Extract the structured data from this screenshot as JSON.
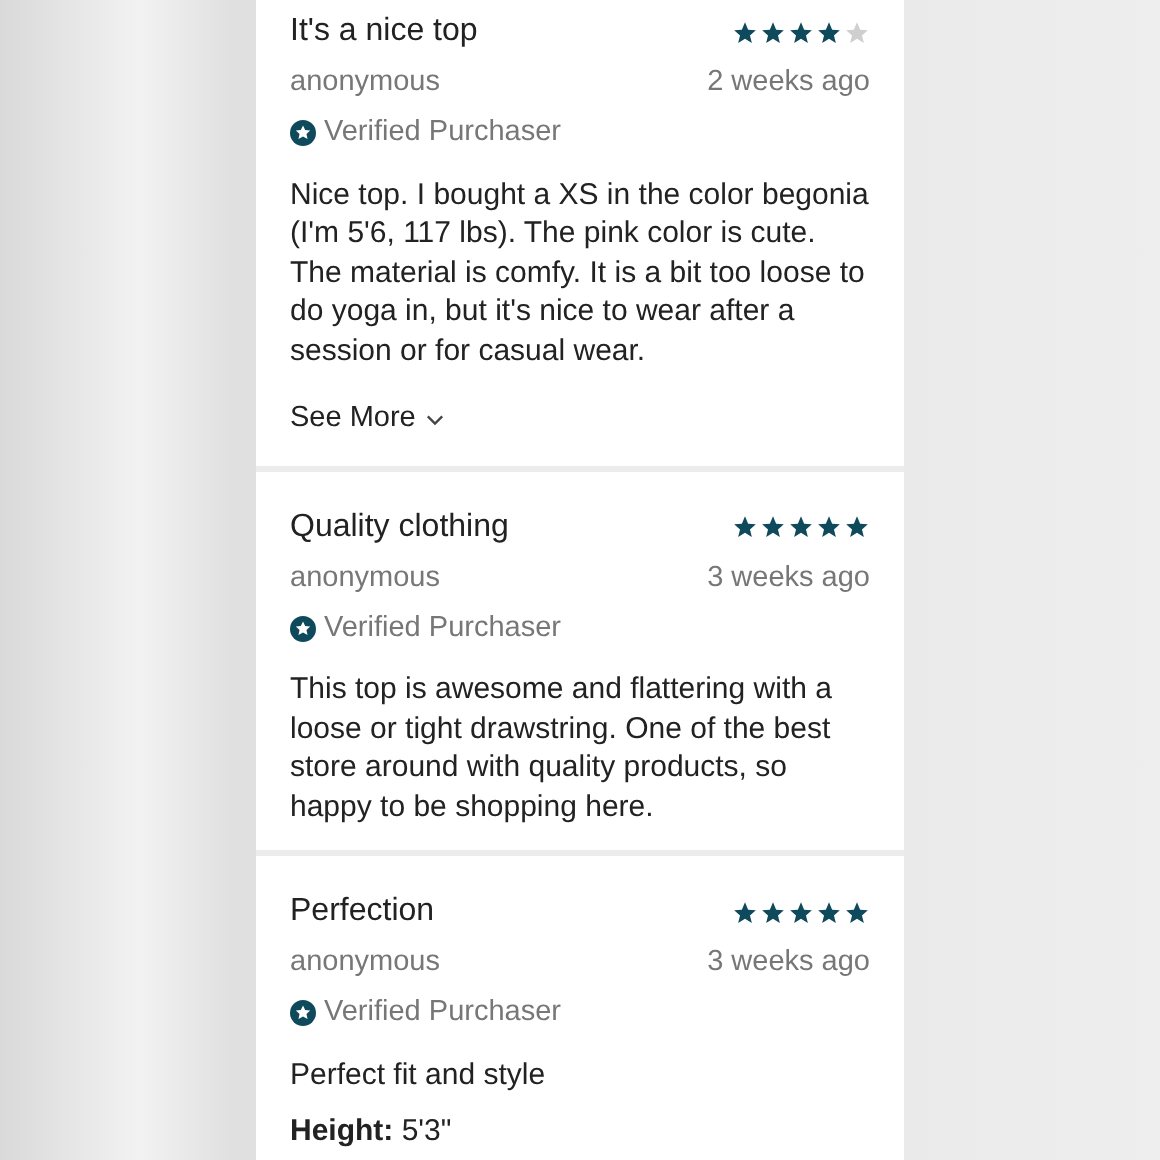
{
  "reviews": [
    {
      "title": "It's a nice top",
      "stars": 4,
      "author": "anonymous",
      "date": "2 weeks ago",
      "badge": "Verified Purchaser",
      "body": "Nice top. I bought a XS in the color begonia (I'm 5'6, 117 lbs). The pink color is cute. The material is comfy. It is a bit too loose to do yoga in, but it's nice to wear after a session or for casual wear.",
      "see_more": "See More"
    },
    {
      "title": "Quality clothing",
      "stars": 5,
      "author": "anonymous",
      "date": "3 weeks ago",
      "badge": "Verified Purchaser",
      "body": "This top is awesome and flattering with a loose or tight drawstring. One of the best store around with quality products, so happy to be shopping here."
    },
    {
      "title": "Perfection",
      "stars": 5,
      "author": "anonymous",
      "date": "3 weeks ago",
      "badge": "Verified Purchaser",
      "body": "Perfect fit and style",
      "detail": "**Height:** 5'3\""
    }
  ]
}
